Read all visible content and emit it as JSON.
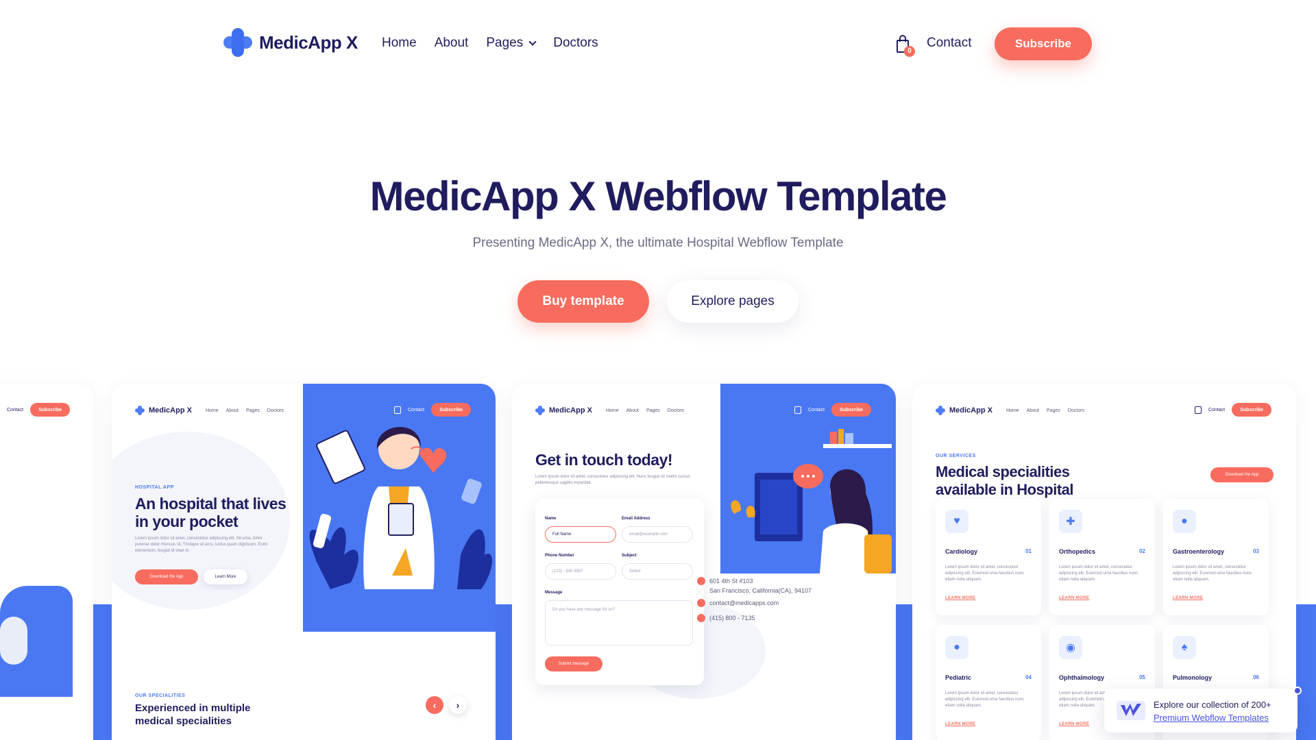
{
  "nav": {
    "brand": "MedicApp X",
    "links": [
      "Home",
      "About",
      "Pages",
      "Doctors"
    ],
    "cart_count": "0",
    "contact": "Contact",
    "subscribe": "Subscribe"
  },
  "hero": {
    "title": "MedicApp X Webflow Template",
    "subtitle": "Presenting MedicApp X, the ultimate Hospital Webflow Template",
    "buy_button": "Buy template",
    "explore_button": "Explore pages"
  },
  "previews": {
    "mini_nav": {
      "brand": "MedicApp X",
      "links": [
        "Home",
        "About",
        "Pages",
        "Doctors"
      ],
      "contact": "Contact",
      "subscribe": "Subscribe"
    },
    "home": {
      "eyebrow": "HOSPITAL APP",
      "title": "An hospital that lives in your pocket",
      "body": "Lorem ipsum dolor sit amet, consectetur adipiscing elit. Sit urna, tortor pulvinar dolor rhoncus sit. Tristique sit arcu, luctus quam dignissim. Enim elementum, feugiat id vitae in.",
      "primary_btn": "Download the App",
      "secondary_btn": "Learn More",
      "specialities_eyebrow": "OUR SPECIALITIES",
      "specialities_title": "Experienced in multiple medical specialities",
      "prev_arrow": "‹",
      "next_arrow": "›"
    },
    "contact": {
      "title": "Get in touch today!",
      "body": "Lorem ipsum dolor sit amet, consectetur adipiscing elit. Nunc feugiat sit mattis cursus pellentesque sagittis imperdiet.",
      "fields": {
        "name_label": "Name",
        "name_value": "Full Name",
        "email_label": "Email Address",
        "email_placeholder": "email@example.com",
        "phone_label": "Phone Number",
        "phone_placeholder": "(123) - 840 3987",
        "subject_label": "Subject",
        "subject_value": "Select",
        "message_label": "Message",
        "message_placeholder": "Do you have any message for us?"
      },
      "submit": "Submit message",
      "address_line1": "601 4th St #103",
      "address_line2": "San Francisco, California(CA), 94107",
      "email": "contact@medicappx.com",
      "phone": "(415) 800 - 7135"
    },
    "services": {
      "eyebrow": "OUR SERVICES",
      "title": "Medical specialities available in Hospital",
      "cta": "Download the App",
      "tile_body": "Lorem ipsum dolor sit amet, consectetur adipiscing elit. Euismod urna faucibus nunc etiam nulla aliquam.",
      "tile_link": "LEARN MORE",
      "tiles": [
        {
          "name": "Cardiology",
          "num": "01",
          "icon": "heart-icon"
        },
        {
          "name": "Orthopedics",
          "num": "02",
          "icon": "bone-icon"
        },
        {
          "name": "Gastroenterology",
          "num": "03",
          "icon": "stomach-icon"
        },
        {
          "name": "Pediatric",
          "num": "04",
          "icon": "teddy-bear-icon"
        },
        {
          "name": "Ophthalmology",
          "num": "05",
          "icon": "eye-icon"
        },
        {
          "name": "Pulmonology",
          "num": "06",
          "icon": "lungs-icon"
        }
      ]
    }
  },
  "promo": {
    "line1": "Explore our collection of 200+",
    "link": "Premium Webflow Templates"
  },
  "colors": {
    "navy": "#1f1d5e",
    "coral": "#f76c5e",
    "blue": "#4a78f3"
  }
}
